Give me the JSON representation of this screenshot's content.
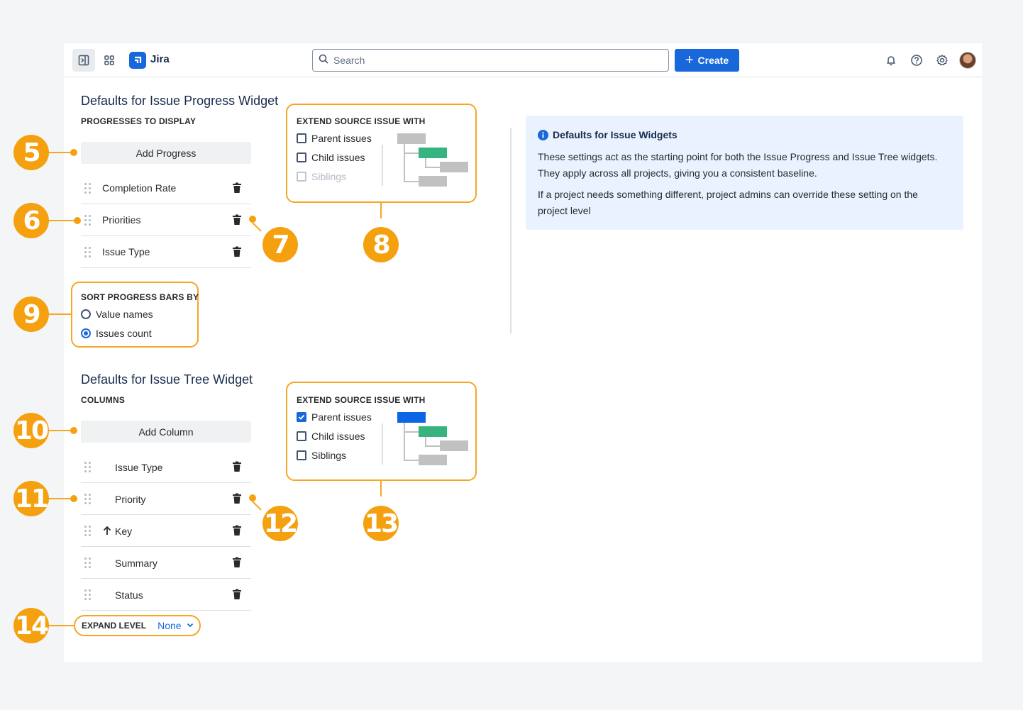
{
  "app": {
    "name": "Jira"
  },
  "topbar": {
    "search_placeholder": "Search",
    "create_label": "Create",
    "icons": [
      "sidebar-toggle-icon",
      "app-switcher-icon",
      "bell-icon",
      "help-icon",
      "settings-icon",
      "avatar"
    ]
  },
  "progress_widget": {
    "title": "Defaults for Issue Progress Widget",
    "progresses_heading": "PROGRESSES TO DISPLAY",
    "add_button": "Add Progress",
    "items": [
      "Completion Rate",
      "Priorities",
      "Issue Type"
    ],
    "extend": {
      "heading": "EXTEND SOURCE ISSUE WITH",
      "options": [
        {
          "label": "Parent issues",
          "checked": false,
          "disabled": false
        },
        {
          "label": "Child issues",
          "checked": false,
          "disabled": false
        },
        {
          "label": "Siblings",
          "checked": false,
          "disabled": true
        }
      ]
    },
    "sort": {
      "heading": "SORT PROGRESS BARS BY",
      "options": [
        {
          "label": "Value names",
          "selected": false
        },
        {
          "label": "Issues count",
          "selected": true
        }
      ]
    }
  },
  "tree_widget": {
    "title": "Defaults for Issue Tree Widget",
    "columns_heading": "COLUMNS",
    "add_button": "Add Column",
    "columns": [
      "Issue Type",
      "Priority",
      "Key",
      "Summary",
      "Status"
    ],
    "extend": {
      "heading": "EXTEND SOURCE ISSUE WITH",
      "options": [
        {
          "label": "Parent issues",
          "checked": true,
          "disabled": false
        },
        {
          "label": "Child issues",
          "checked": false,
          "disabled": false
        },
        {
          "label": "Siblings",
          "checked": false,
          "disabled": false
        }
      ]
    },
    "expand_level": {
      "label": "EXPAND LEVEL",
      "value": "None"
    }
  },
  "info": {
    "title": "Defaults for Issue Widgets",
    "line1": "These settings act as the starting point for both the Issue Progress and Issue Tree widgets.",
    "line2": "They apply across all projects, giving you a consistent baseline.",
    "line3": "If a project needs something different, project admins can override these setting on the project level"
  },
  "callouts": [
    "5",
    "6",
    "7",
    "8",
    "9",
    "10",
    "11",
    "12",
    "13",
    "14"
  ],
  "colors": {
    "accent": "#1868db",
    "callout": "#f5a00f",
    "tree_highlight_green": "#36b37e",
    "tree_highlight_blue": "#0c66e4",
    "tree_gray": "#c1c1c1",
    "info_bg": "#e9f2fe"
  }
}
